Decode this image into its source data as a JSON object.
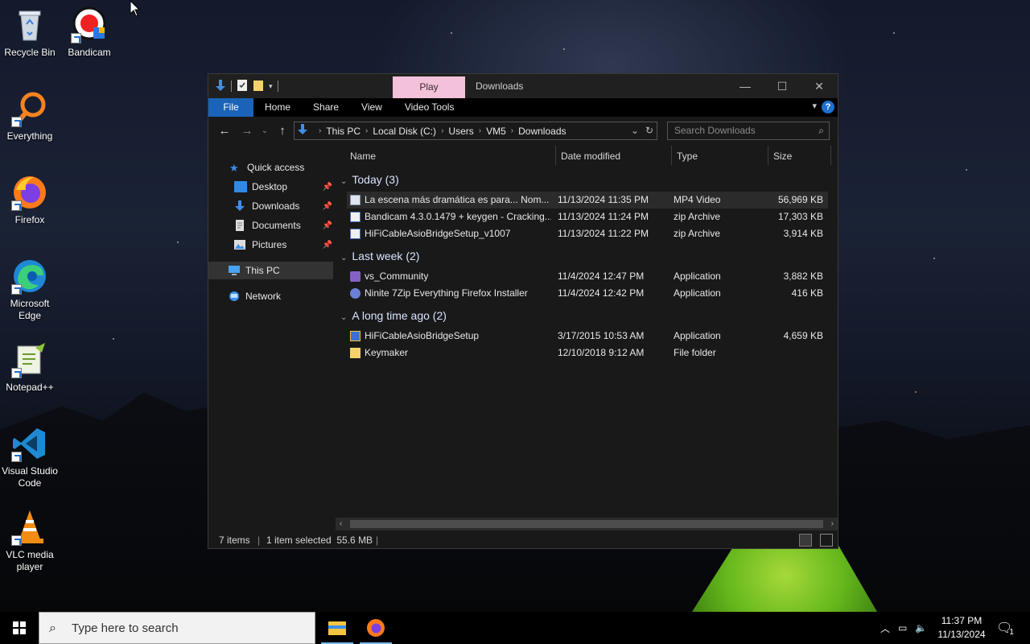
{
  "desktop": {
    "icons": [
      {
        "label": "Recycle Bin"
      },
      {
        "label": "Bandicam"
      },
      {
        "label": "Everything"
      },
      {
        "label": "Firefox"
      },
      {
        "label": "Microsoft Edge"
      },
      {
        "label": "Notepad++"
      },
      {
        "label": "Visual Studio Code"
      },
      {
        "label": "VLC media player"
      }
    ]
  },
  "window": {
    "title": "Downloads",
    "contextual_tab": "Play",
    "ribbon_tabs": [
      "File",
      "Home",
      "Share",
      "View",
      "Video Tools"
    ],
    "help_label": "?",
    "address": {
      "crumbs": [
        "This PC",
        "Local Disk (C:)",
        "Users",
        "VM5",
        "Downloads"
      ]
    },
    "search": {
      "placeholder": "Search Downloads"
    },
    "nav_pane": {
      "quick_access": "Quick access",
      "items": [
        {
          "label": "Desktop",
          "pinned": true
        },
        {
          "label": "Downloads",
          "pinned": true
        },
        {
          "label": "Documents",
          "pinned": true
        },
        {
          "label": "Pictures",
          "pinned": true
        }
      ],
      "this_pc": "This PC",
      "network": "Network"
    },
    "columns": {
      "name": "Name",
      "date": "Date modified",
      "type": "Type",
      "size": "Size"
    },
    "groups": [
      {
        "label": "Today (3)",
        "files": [
          {
            "name": "La escena más dramática es para... Nom...",
            "date": "11/13/2024 11:35 PM",
            "type": "MP4 Video",
            "size": "56,969 KB",
            "icon": "video-file-icon",
            "selected": true
          },
          {
            "name": "Bandicam 4.3.0.1479 + keygen - Cracking...",
            "date": "11/13/2024 11:24 PM",
            "type": "zip Archive",
            "size": "17,303 KB",
            "icon": "zip-archive-icon"
          },
          {
            "name": "HiFiCableAsioBridgeSetup_v1007",
            "date": "11/13/2024 11:22 PM",
            "type": "zip Archive",
            "size": "3,914 KB",
            "icon": "zip-archive-icon"
          }
        ]
      },
      {
        "label": "Last week (2)",
        "files": [
          {
            "name": "vs_Community",
            "date": "11/4/2024 12:47 PM",
            "type": "Application",
            "size": "3,882 KB",
            "icon": "visual-studio-icon"
          },
          {
            "name": "Ninite 7Zip Everything Firefox Installer",
            "date": "11/4/2024 12:42 PM",
            "type": "Application",
            "size": "416 KB",
            "icon": "ninite-icon"
          }
        ]
      },
      {
        "label": "A long time ago (2)",
        "files": [
          {
            "name": "HiFiCableAsioBridgeSetup",
            "date": "3/17/2015 10:53 AM",
            "type": "Application",
            "size": "4,659 KB",
            "icon": "installer-icon"
          },
          {
            "name": "Keymaker",
            "date": "12/10/2018 9:12 AM",
            "type": "File folder",
            "size": "",
            "icon": "folder-icon"
          }
        ]
      }
    ],
    "status": {
      "items": "7 items",
      "selected": "1 item selected  55.6 MB"
    }
  },
  "taskbar": {
    "search_placeholder": "Type here to search",
    "time": "11:37 PM",
    "date": "11/13/2024",
    "notification_count": "1"
  },
  "colors": {
    "accent": "#1a63b8",
    "play_tab": "#f3c1d9",
    "window_bg": "#191919"
  }
}
